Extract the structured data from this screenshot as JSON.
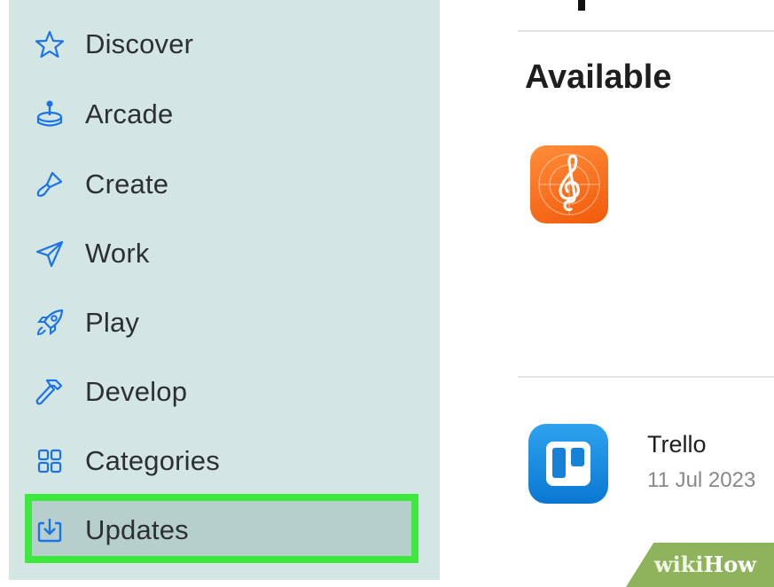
{
  "sidebar": {
    "items": [
      {
        "label": "Discover",
        "icon": "star-icon"
      },
      {
        "label": "Arcade",
        "icon": "joystick-icon"
      },
      {
        "label": "Create",
        "icon": "brush-icon"
      },
      {
        "label": "Work",
        "icon": "paper-plane-icon"
      },
      {
        "label": "Play",
        "icon": "rocket-icon"
      },
      {
        "label": "Develop",
        "icon": "hammer-icon"
      },
      {
        "label": "Categories",
        "icon": "grid-icon"
      },
      {
        "label": "Updates",
        "icon": "download-icon"
      }
    ],
    "selected": "Updates",
    "highlight_color": "#3ee83e",
    "accent_color": "#1a73e8"
  },
  "main": {
    "section_title": "Available",
    "apps": [
      {
        "name": "",
        "date": "",
        "icon": "music-notation-app-icon"
      },
      {
        "name": "Trello",
        "date": "11 Jul 2023",
        "icon": "trello-icon"
      }
    ]
  },
  "watermark": {
    "part1": "wiki",
    "part2": "How"
  }
}
